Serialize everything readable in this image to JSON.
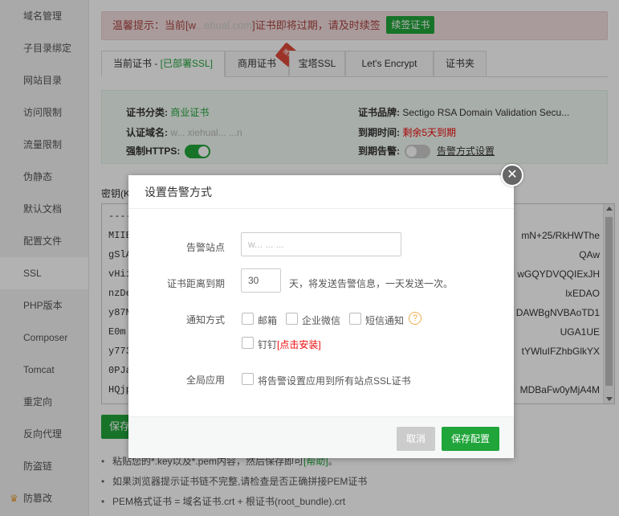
{
  "sidebar": {
    "items": [
      {
        "label": "域名管理"
      },
      {
        "label": "子目录绑定"
      },
      {
        "label": "网站目录"
      },
      {
        "label": "访问限制"
      },
      {
        "label": "流量限制"
      },
      {
        "label": "伪静态"
      },
      {
        "label": "默认文档"
      },
      {
        "label": "配置文件"
      },
      {
        "label": "SSL",
        "active": true
      },
      {
        "label": "PHP版本"
      },
      {
        "label": "Composer"
      },
      {
        "label": "Tomcat"
      },
      {
        "label": "重定向"
      },
      {
        "label": "反向代理"
      },
      {
        "label": "防盗链"
      },
      {
        "label": "防篡改",
        "icon": "crown-icon"
      }
    ]
  },
  "alert": {
    "text_before": "温馨提示：当前[w",
    "text_domain": "...ehual.com",
    "text_after": "]证书即将过期，请及时续签",
    "renew_label": "续签证书"
  },
  "tabs": [
    {
      "label": "当前证书 - ",
      "status": "[已部署SSL]",
      "active": true
    },
    {
      "label": "商用证书",
      "badge": "推荐"
    },
    {
      "label": "宝塔SSL"
    },
    {
      "label": "Let's Encrypt"
    },
    {
      "label": "证书夹"
    }
  ],
  "cert_info": {
    "category_label": "证书分类:",
    "category_value": "商业证书",
    "brand_label": "证书品牌:",
    "brand_value": "Sectigo RSA Domain Validation Secu...",
    "domain_label": "认证域名:",
    "domain_value": "w... xiehual... ...n",
    "expire_label": "到期时间:",
    "expire_value": "剩余5天到期",
    "https_label": "强制HTTPS:",
    "https_on": true,
    "alert_label": "到期告警:",
    "alert_on": false,
    "alert_link": "告警方式设置"
  },
  "key_area": {
    "label": "密钥(K",
    "lines_left": [
      "----",
      "MIIE",
      "gSlA",
      "vHii",
      "nzDe",
      "y87M",
      "E0m",
      "y773",
      "0PJa",
      "HQjp"
    ],
    "lines_right": [
      "",
      "mN+25/RkHWThe",
      "QAw",
      "wGQYDVQQIExJH",
      "lxEDAO",
      "DAWBgNVBAoTD1",
      "UGA1UE",
      "tYWluIFZhbGlkYX",
      "",
      "MDBaFw0yMjA4M"
    ]
  },
  "save_main_label": "保存",
  "tips": [
    {
      "text": "粘贴您的*.key以及*.pem内容，然后保存即可",
      "link": "[帮助]",
      "tail": "。"
    },
    {
      "text": "如果浏览器提示证书链不完整,请检查是否正确拼接PEM证书"
    },
    {
      "text": "PEM格式证书 = 域名证书.crt + 根证书(root_bundle).crt"
    }
  ],
  "dialog": {
    "title": "设置告警方式",
    "site_label": "告警站点",
    "site_value": "w... ... ...",
    "days_label": "证书距离到期",
    "days_value": "30",
    "days_suffix": "天，将发送告警信息，一天发送一次。",
    "notify_label": "通知方式",
    "options": {
      "email": "邮箱",
      "wechat": "企业微信",
      "sms": "短信通知",
      "dingding": "钉钉",
      "dingding_install": "[点击安装]"
    },
    "global_label": "全局应用",
    "global_text": "将告警设置应用到所有站点SSL证书",
    "cancel_label": "取消",
    "save_label": "保存配置"
  },
  "colors": {
    "primary_green": "#20a53a",
    "alert_red": "#ef0808",
    "alert_bg": "#f2dede"
  }
}
